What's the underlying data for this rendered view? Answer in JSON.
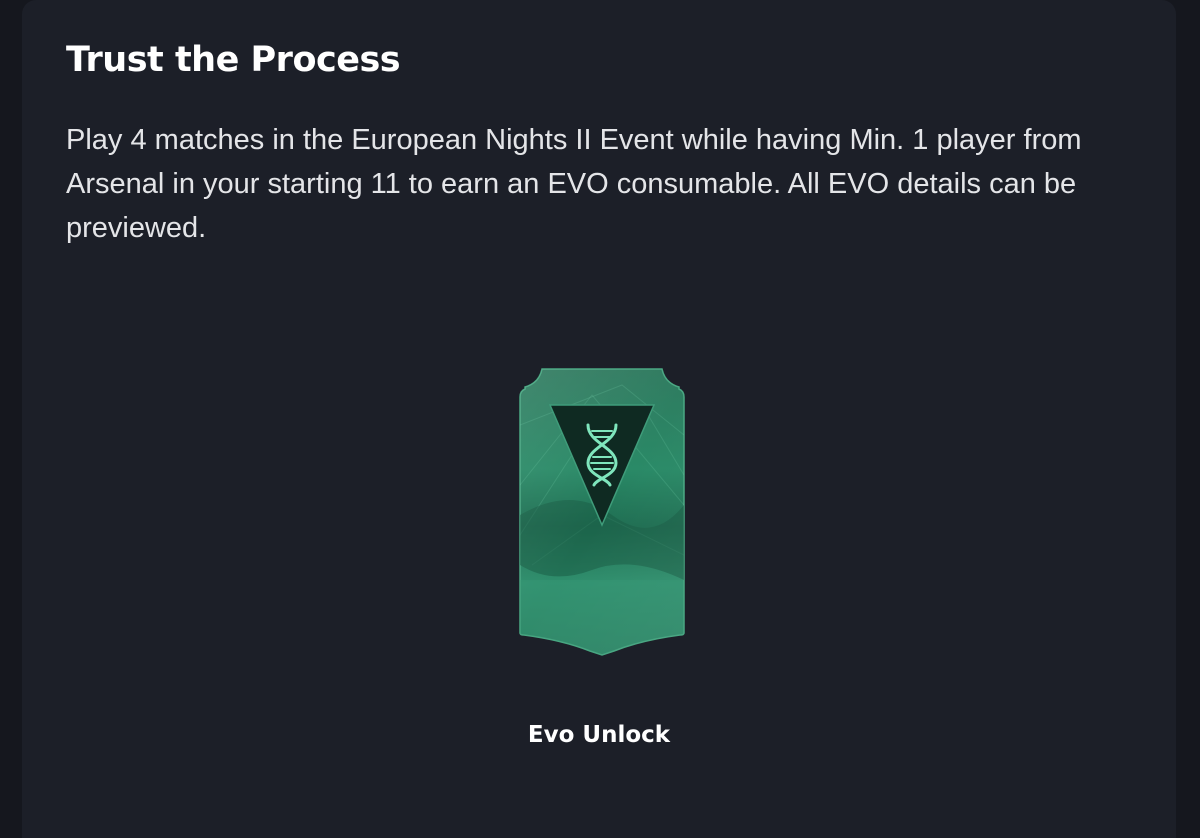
{
  "objective": {
    "title": "Trust the Process",
    "description": "Play 4 matches in the European Nights II Event while having Min. 1 player from Arsenal in your starting 11 to earn an EVO consumable. All EVO details can be previewed."
  },
  "reward": {
    "label": "Evo Unlock",
    "icon": "dna-icon",
    "card_color": "#2e8a66",
    "accent_color": "#6fe0b0"
  }
}
